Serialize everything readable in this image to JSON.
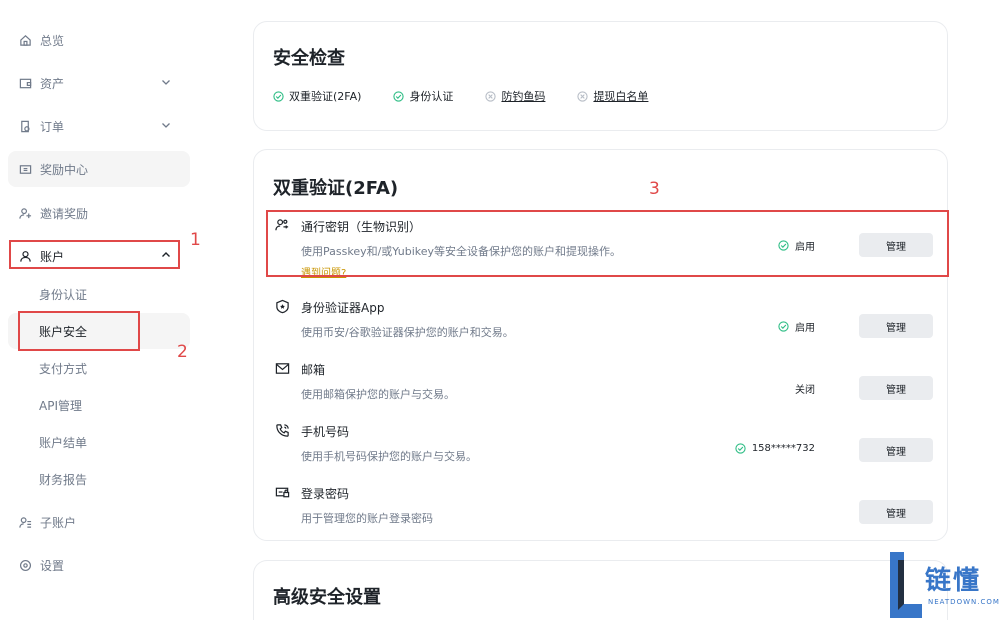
{
  "sidebar": {
    "items": [
      {
        "label": "总览",
        "icon": "home-icon"
      },
      {
        "label": "资产",
        "icon": "wallet-icon"
      },
      {
        "label": "订单",
        "icon": "order-icon"
      },
      {
        "label": "奖励中心",
        "icon": "ticket-icon"
      },
      {
        "label": "邀请奖励",
        "icon": "add-user-icon"
      },
      {
        "label": "账户",
        "icon": "user-icon"
      },
      {
        "label": "子账户",
        "icon": "sub-account-icon"
      },
      {
        "label": "设置",
        "icon": "settings-icon"
      }
    ],
    "account_sub": [
      {
        "label": "身份认证"
      },
      {
        "label": "账户安全"
      },
      {
        "label": "支付方式"
      },
      {
        "label": "API管理"
      },
      {
        "label": "账户结单"
      },
      {
        "label": "财务报告"
      }
    ]
  },
  "annotations": {
    "n1": "1",
    "n2": "2",
    "n3": "3",
    "color": "#e04848"
  },
  "security_check": {
    "title": "安全检查",
    "items": [
      {
        "label": "双重验证(2FA)",
        "state": "done"
      },
      {
        "label": "身份认证",
        "state": "done"
      },
      {
        "label": "防钓鱼码",
        "state": "todo"
      },
      {
        "label": "提现白名单",
        "state": "todo"
      }
    ]
  },
  "twofa": {
    "title": "双重验证(2FA)",
    "rows": [
      {
        "title": "通行密钥（生物识别）",
        "desc": "使用Passkey和/或Yubikey等安全设备保护您的账户和提现操作。",
        "link": "遇到问题?",
        "status": "启用",
        "button": "管理"
      },
      {
        "title": "身份验证器App",
        "desc": "使用币安/谷歌验证器保护您的账户和交易。",
        "status": "启用",
        "button": "管理"
      },
      {
        "title": "邮箱",
        "desc": "使用邮箱保护您的账户与交易。",
        "status": "关闭",
        "button": "管理"
      },
      {
        "title": "手机号码",
        "desc": "使用手机号码保护您的账户与交易。",
        "status": "158*****732",
        "button": "管理"
      },
      {
        "title": "登录密码",
        "desc": "用于管理您的账户登录密码",
        "status": "",
        "button": "管理"
      }
    ]
  },
  "advanced": {
    "title": "高级安全设置"
  },
  "watermark": {
    "name": "链懂",
    "domain": "NEATDOWN.COM",
    "color": "#3876c8"
  },
  "colors": {
    "success": "#2ebd85",
    "text": "#1e2329",
    "muted": "#707a8a",
    "link": "#c99400"
  }
}
